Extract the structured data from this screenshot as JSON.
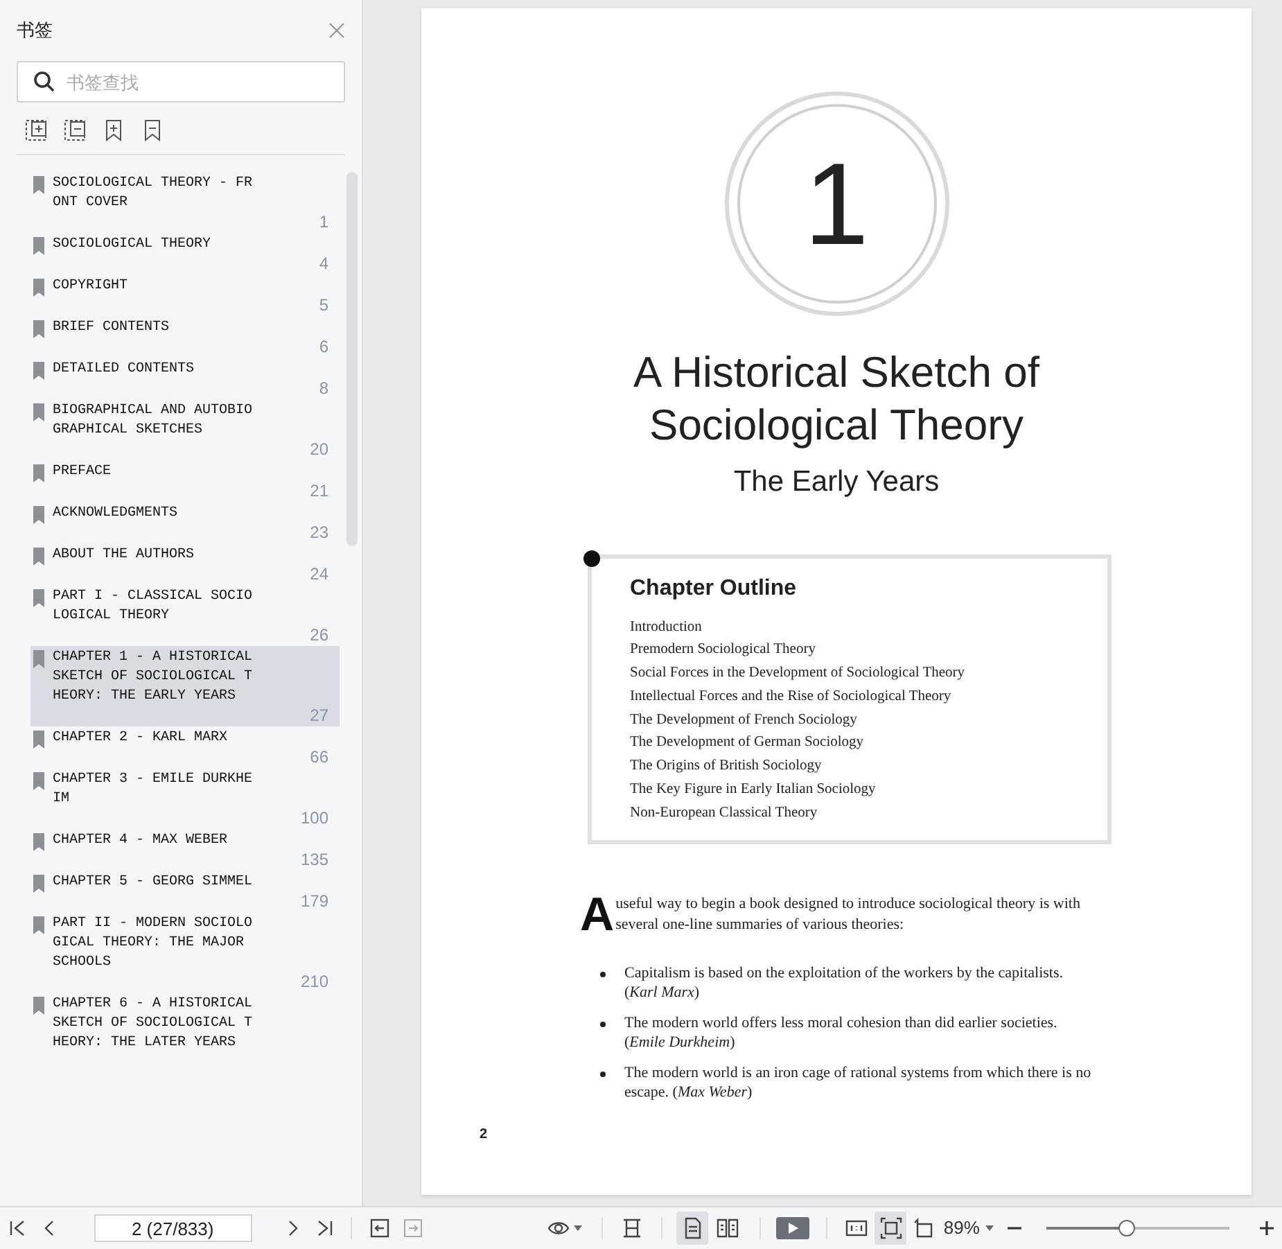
{
  "sidebar": {
    "title": "书签",
    "search": {
      "placeholder": "书签查找"
    },
    "bookmarks": [
      {
        "title": "SOCIOLOGICAL THEORY - FRONT COVER",
        "page": "1",
        "selected": false
      },
      {
        "title": "SOCIOLOGICAL THEORY",
        "page": "4",
        "selected": false
      },
      {
        "title": "COPYRIGHT",
        "page": "5",
        "selected": false
      },
      {
        "title": "BRIEF CONTENTS",
        "page": "6",
        "selected": false
      },
      {
        "title": "DETAILED CONTENTS",
        "page": "8",
        "selected": false
      },
      {
        "title": "BIOGRAPHICAL AND AUTOBIOGRAPHICAL SKETCHES",
        "page": "20",
        "selected": false
      },
      {
        "title": "PREFACE",
        "page": "21",
        "selected": false
      },
      {
        "title": "ACKNOWLEDGMENTS",
        "page": "23",
        "selected": false
      },
      {
        "title": "ABOUT THE AUTHORS",
        "page": "24",
        "selected": false
      },
      {
        "title": "PART I - CLASSICAL SOCIOLOGICAL THEORY",
        "page": "26",
        "selected": false
      },
      {
        "title": "CHAPTER 1 - A HISTORICAL SKETCH OF SOCIOLOGICAL THEORY: THE EARLY YEARS",
        "page": "27",
        "selected": true
      },
      {
        "title": "CHAPTER 2 - KARL MARX",
        "page": "66",
        "selected": false
      },
      {
        "title": "CHAPTER 3 - EMILE DURKHEIM",
        "page": "100",
        "selected": false
      },
      {
        "title": "CHAPTER 4 - MAX WEBER",
        "page": "135",
        "selected": false
      },
      {
        "title": "CHAPTER 5 - GEORG SIMMEL",
        "page": "179",
        "selected": false
      },
      {
        "title": "PART II - MODERN SOCIOLOGICAL THEORY: THE MAJOR SCHOOLS",
        "page": "210",
        "selected": false
      },
      {
        "title": "CHAPTER 6 - A HISTORICAL SKETCH OF SOCIOLOGICAL THEORY: THE LATER YEARS",
        "selected": false
      }
    ]
  },
  "page": {
    "chapter_number": "1",
    "title": "A Historical Sketch of Sociological Theory",
    "subtitle": "The Early Years",
    "outline": {
      "heading": "Chapter Outline",
      "items": [
        "Introduction",
        "Premodern Sociological Theory",
        "Social Forces in the Development of Sociological Theory",
        "Intellectual Forces and the Rise of Sociological Theory",
        "The Development of French Sociology",
        "The Development of German Sociology",
        "The Origins of British Sociology",
        "The Key Figure in Early Italian Sociology",
        "Non-European Classical Theory"
      ]
    },
    "intro": {
      "drop_cap": "A",
      "text": "useful way to begin a book designed to introduce sociological theory is with several one-line summaries of various theories:"
    },
    "bullets": [
      "Capitalism is based on the exploitation of the workers by the capitalists. (*Karl Marx*)",
      "The modern world offers less moral cohesion than did earlier societies. (*Emile Durkheim*)",
      "The modern world is an iron cage of rational systems from which there is no escape. (*Max Weber*)"
    ],
    "page_number": "2"
  },
  "toolbar": {
    "page_field": "2 (27/833)",
    "view_modes": [
      {
        "selected": true
      },
      {
        "selected": false
      }
    ],
    "fit_modes": [
      {
        "selected": false
      },
      {
        "selected": true
      }
    ],
    "zoom": "89%",
    "zoom_slider": {
      "level": 0.44
    }
  }
}
